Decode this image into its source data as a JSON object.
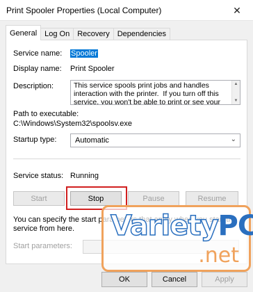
{
  "window": {
    "title": "Print Spooler Properties (Local Computer)",
    "close_glyph": "✕"
  },
  "tabs": [
    {
      "label": "General",
      "active": true
    },
    {
      "label": "Log On",
      "active": false
    },
    {
      "label": "Recovery",
      "active": false
    },
    {
      "label": "Dependencies",
      "active": false
    }
  ],
  "general": {
    "service_name_label": "Service name:",
    "service_name_value": "Spooler",
    "display_name_label": "Display name:",
    "display_name_value": "Print Spooler",
    "description_label": "Description:",
    "description_value": "This service spools print jobs and handles interaction with the printer.  If you turn off this service, you won't be able to print or see your printers.",
    "path_label": "Path to executable:",
    "path_value": "C:\\Windows\\System32\\spoolsv.exe",
    "startup_type_label": "Startup type:",
    "startup_type_value": "Automatic",
    "service_status_label": "Service status:",
    "service_status_value": "Running",
    "buttons": {
      "start": "Start",
      "stop": "Stop",
      "pause": "Pause",
      "resume": "Resume"
    },
    "params_hint": "You can specify the start parameters that apply when you start the service from here.",
    "start_params_label": "Start parameters:",
    "start_params_value": ""
  },
  "footer": {
    "ok": "OK",
    "cancel": "Cancel",
    "apply": "Apply"
  },
  "watermark": {
    "brand_a": "Variety",
    "brand_b": "PC",
    "brand_c": ".net"
  },
  "colors": {
    "selection": "#0078d7",
    "highlight_frame": "#d11f1f",
    "watermark_blue": "#2a6fbf",
    "watermark_orange": "#f0a25c"
  }
}
